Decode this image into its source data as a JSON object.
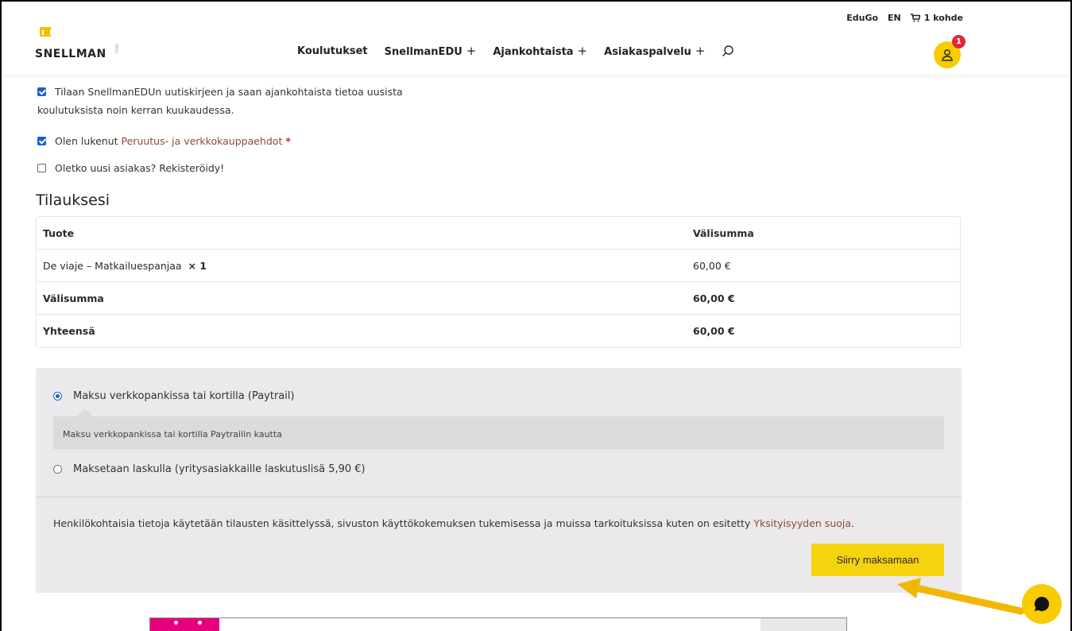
{
  "header": {
    "topbar": {
      "edugo": "EduGo",
      "lang": "EN",
      "cart": "1 kohde"
    },
    "logo_text": "SNELLMAN",
    "logo_sub": "EDU",
    "nav": [
      {
        "label": "Koulutukset"
      },
      {
        "label": "SnellmanEDU",
        "plus": "+"
      },
      {
        "label": "Ajankohtaista",
        "plus": "+"
      },
      {
        "label": "Asiakaspalvelu",
        "plus": "+"
      }
    ],
    "account_badge": "1"
  },
  "checkout": {
    "newsletter_line1": "Tilaan SnellmanEDUn uutiskirjeen ja saan ajankohtaista tietoa uusista",
    "newsletter_line2": "koulutuksista noin kerran kuukaudessa.",
    "terms_prefix": "Olen lukenut",
    "terms_link": "Peruutus- ja verkkokauppaehdot",
    "terms_required": "*",
    "register": "Oletko uusi asiakas? Rekisteröidy!"
  },
  "order": {
    "title": "Tilauksesi",
    "headers": {
      "product": "Tuote",
      "subtotal": "Välisumma"
    },
    "item": {
      "name": "De viaje – Matkailuespanjaa",
      "qty": "× 1",
      "price": "60,00 €"
    },
    "subtotal_label": "Välisumma",
    "subtotal_value": "60,00 €",
    "total_label": "Yhteensä",
    "total_value": "60,00 €"
  },
  "payment": {
    "option1": "Maksu verkkopankissa tai kortilla (Paytrail)",
    "option1_desc": "Maksu verkkopankissa tai kortilla Paytrailin kautta",
    "option2": "Maksetaan laskulla (yritysasiakkaille laskutuslisä 5,90 €)",
    "privacy_text": "Henkilökohtaisia tietoja käytetään tilausten käsittelyssä, sivuston käyttökokemuksen tukemisessa ja muissa tarkoituksissa kuten on esitetty",
    "privacy_link": "Yksityisyyden suoja",
    "privacy_end": ".",
    "button": "Siirry maksamaan"
  },
  "colors": {
    "accent": "#f6d30f",
    "link": "#8a4b3a",
    "badge": "#e4253d",
    "arrow": "#f2b705"
  }
}
